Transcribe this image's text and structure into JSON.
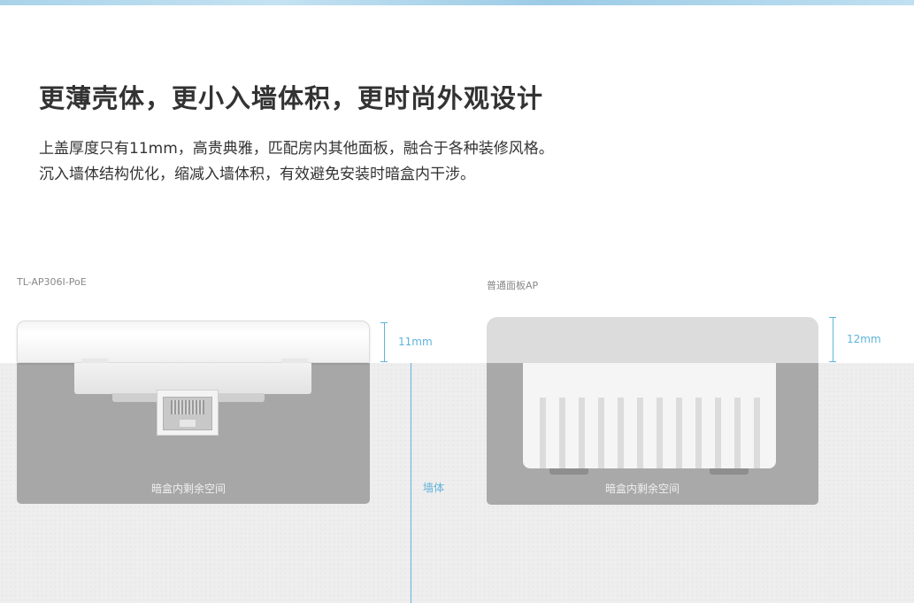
{
  "headline": "更薄壳体，更小入墙体积，更时尚外观设计",
  "description": [
    "上盖厚度只有11mm，高贵典雅，匹配房内其他面板，融合于各种装修风格。",
    "沉入墙体结构优化，缩减入墙体积，有效避免安装时暗盒内干涉。"
  ],
  "left_product": {
    "name": "TL-AP306I-PoE",
    "thickness": "11mm",
    "caption": "暗盒内剩余空间"
  },
  "right_product": {
    "name": "普通面板AP",
    "thickness": "12mm",
    "caption": "暗盒内剩余空间"
  },
  "wall_label": "墙体",
  "colors": {
    "accent": "#5fb3da",
    "text": "#333333",
    "wall": "#eeeeee",
    "box": "#a7a7a7"
  }
}
